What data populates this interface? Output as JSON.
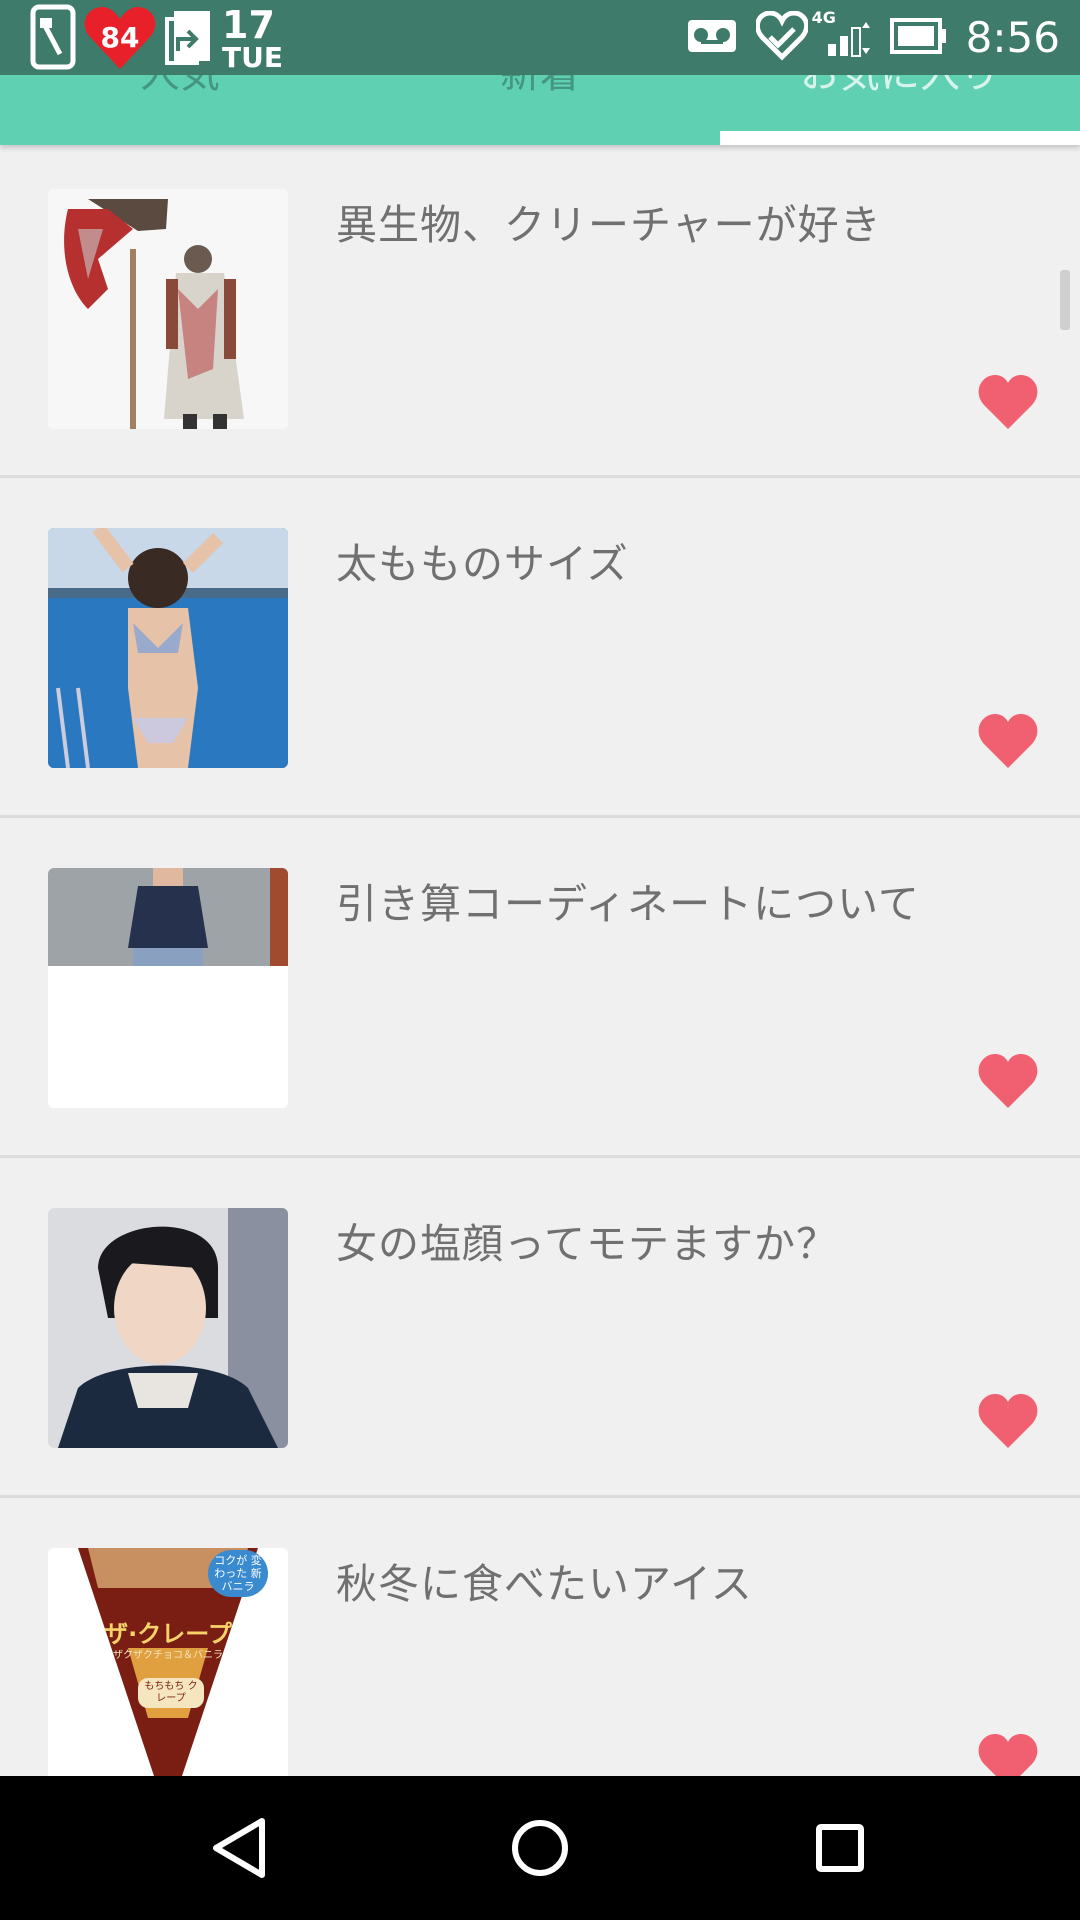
{
  "status_bar": {
    "heart_count": "84",
    "date_day": "17",
    "date_weekday": "TUE",
    "network": "4G",
    "time": "8:56"
  },
  "tabs": [
    {
      "label": "人気",
      "active": false
    },
    {
      "label": "新着",
      "active": false
    },
    {
      "label": "お気に入り",
      "active": true
    }
  ],
  "accent_color": "#5fd0b2",
  "favorite_color": "#f06070",
  "items": [
    {
      "title": "異生物、クリーチャーが好き",
      "favorited": true
    },
    {
      "title": "太もものサイズ",
      "favorited": true
    },
    {
      "title": "引き算コーディネートについて",
      "favorited": true
    },
    {
      "title": "女の塩顔ってモテますか？",
      "favorited": true
    },
    {
      "title": "秋冬に食べたいアイス",
      "favorited": true
    }
  ],
  "thumbnail_texts": {
    "item5_badge": "コクが 変わった 新 バニラ",
    "item5_name": "ザ·クレープ",
    "item5_sub": "ザクザクチョコ＆バニラ",
    "item5_tag": "もちもち クレープ"
  }
}
